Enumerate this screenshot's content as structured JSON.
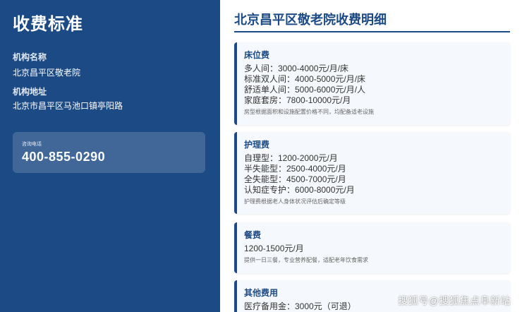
{
  "left": {
    "title": "收费标准",
    "org_name_label": "机构名称",
    "org_name": "北京昌平区敬老院",
    "address_label": "机构地址",
    "address": "北京市昌平区马池口镇亭阳路",
    "phone_label": "咨询电话",
    "phone": "400-855-0290"
  },
  "right": {
    "heading": "北京昌平区敬老院收费明细",
    "cards": [
      {
        "title": "床位费",
        "lines": [
          "多人间：3000-4000元/月/床",
          "标准双人间：4000-5000元/月/床",
          "舒适单人间：5000-6000元/月/人",
          "家庭套房：7800-10000元/月"
        ],
        "note": "房型根据面积和设施配置价格不同，均配备适老设施"
      },
      {
        "title": "护理费",
        "lines": [
          "自理型：1200-2000元/月",
          "半失能型：2500-4000元/月",
          "全失能型：4500-7000元/月",
          "认知症专护：6000-8000元/月"
        ],
        "note": "护理费根据老人身体状况评估后确定等级"
      },
      {
        "title": "餐费",
        "lines": [
          "1200-1500元/月"
        ],
        "note": "提供一日三餐，专业营养配餐，适配老年饮食需求"
      },
      {
        "title": "其他费用",
        "lines": [
          "医疗备用金：3000元（可退）"
        ],
        "note": ""
      }
    ]
  },
  "watermark": "搜狐号@搜狐焦点阜新站"
}
